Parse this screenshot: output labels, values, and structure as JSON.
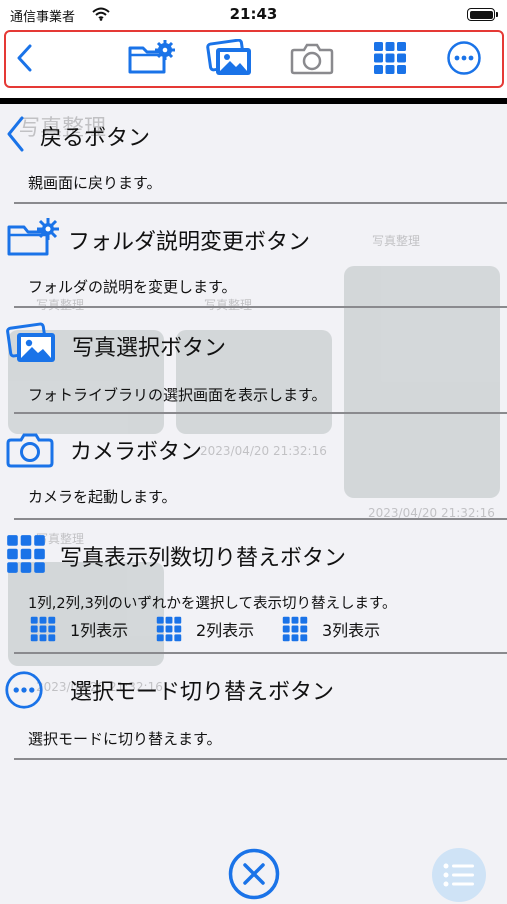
{
  "status_bar": {
    "carrier": "通信事業者",
    "time": "21:43"
  },
  "toolbar": {
    "back": "back-icon",
    "folder_settings": "folder-gear-icon",
    "photos": "photos-icon",
    "camera": "camera-icon",
    "grid": "grid-icon",
    "more": "more-icon",
    "accent_color": "#1a73e8",
    "highlight_color": "#e53935"
  },
  "background": {
    "title": "写真整理",
    "captions": [
      "写真整理",
      "写真整理",
      "写真整理",
      "写真整理"
    ],
    "dates": [
      "2023/04/20 21:32:16",
      "2023/04/20 21:32:16",
      "2023/04/20 21:32:16"
    ]
  },
  "help": {
    "back": {
      "title": "戻るボタン",
      "desc": "親画面に戻ります。"
    },
    "folder": {
      "title": "フォルダ説明変更ボタン",
      "desc": "フォルダの説明を変更します。"
    },
    "photo": {
      "title": "写真選択ボタン",
      "desc": "フォトライブラリの選択画面を表示します。"
    },
    "camera": {
      "title": "カメラボタン",
      "desc": "カメラを起動します。"
    },
    "columns": {
      "title": "写真表示列数切り替えボタン",
      "desc": "1列,2列,3列のいずれかを選択して表示切り替えします。",
      "options": [
        "1列表示",
        "2列表示",
        "3列表示"
      ]
    },
    "select": {
      "title": "選択モード切り替えボタン",
      "desc": "選択モードに切り替えます。"
    }
  },
  "bottom": {
    "close": "close-circle-icon",
    "list": "list-icon"
  }
}
